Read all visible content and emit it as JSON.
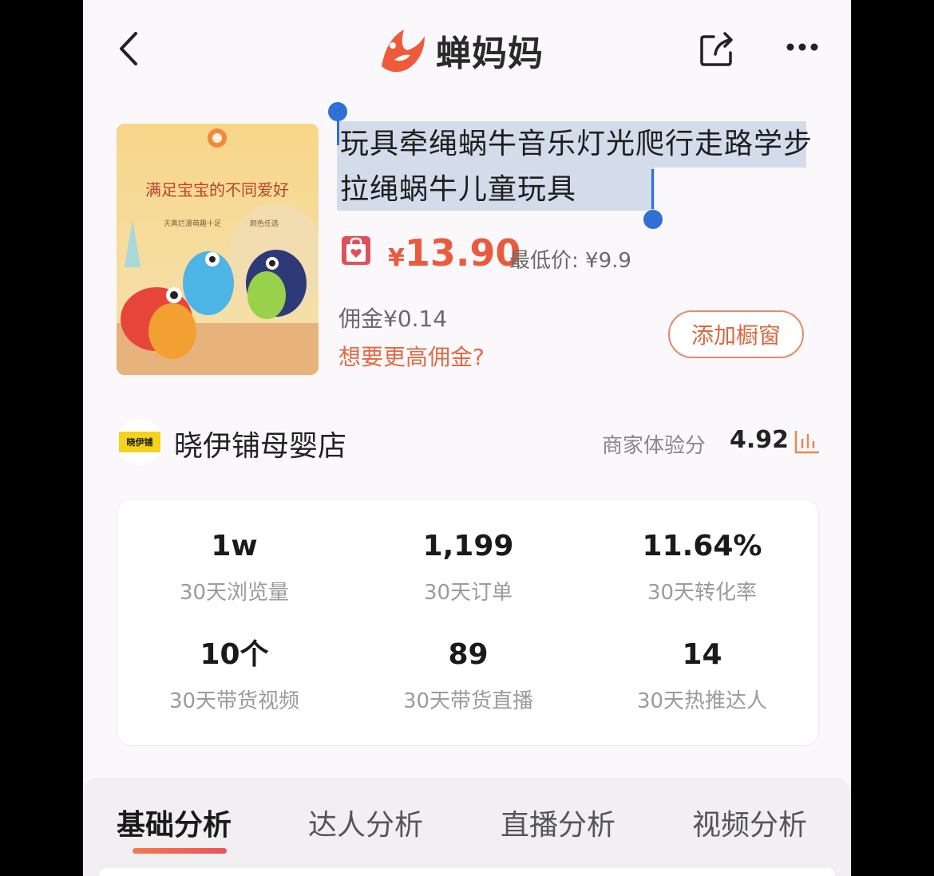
{
  "header": {
    "brand": "蝉妈妈",
    "brand_color": "#ef5a3c"
  },
  "product": {
    "title": "玩具牵绳蜗牛音乐灯光爬行走路学步拉绳蜗牛儿童玩具",
    "price_currency": "¥",
    "price_value": "13.90",
    "min_price": "最低价: ¥9.9",
    "commission": "佣金¥0.14",
    "higher_commission_link": "想要更高佣金?",
    "add_window_label": "添加橱窗",
    "image": {
      "headline": "满足宝宝的不同爱好",
      "sub_left": "天真烂漫萌趣十足",
      "sub_right": "颜色任选"
    }
  },
  "shop": {
    "logo_text": "晓伊铺",
    "name": "晓伊铺母婴店",
    "score_label": "商家体验分",
    "score_value": "4.92"
  },
  "stats": [
    {
      "value": "1w",
      "label": "30天浏览量"
    },
    {
      "value": "1,199",
      "label": "30天订单"
    },
    {
      "value": "11.64%",
      "label": "30天转化率"
    },
    {
      "value": "10个",
      "label": "30天带货视频"
    },
    {
      "value": "89",
      "label": "30天带货直播"
    },
    {
      "value": "14",
      "label": "30天热推达人"
    }
  ],
  "tabs": [
    {
      "label": "基础分析",
      "active": true
    },
    {
      "label": "达人分析",
      "active": false
    },
    {
      "label": "直播分析",
      "active": false
    },
    {
      "label": "视频分析",
      "active": false
    }
  ],
  "colors": {
    "accent": "#ea5a3e",
    "selection": "#d3dcea",
    "handle": "#2f6fd6"
  }
}
